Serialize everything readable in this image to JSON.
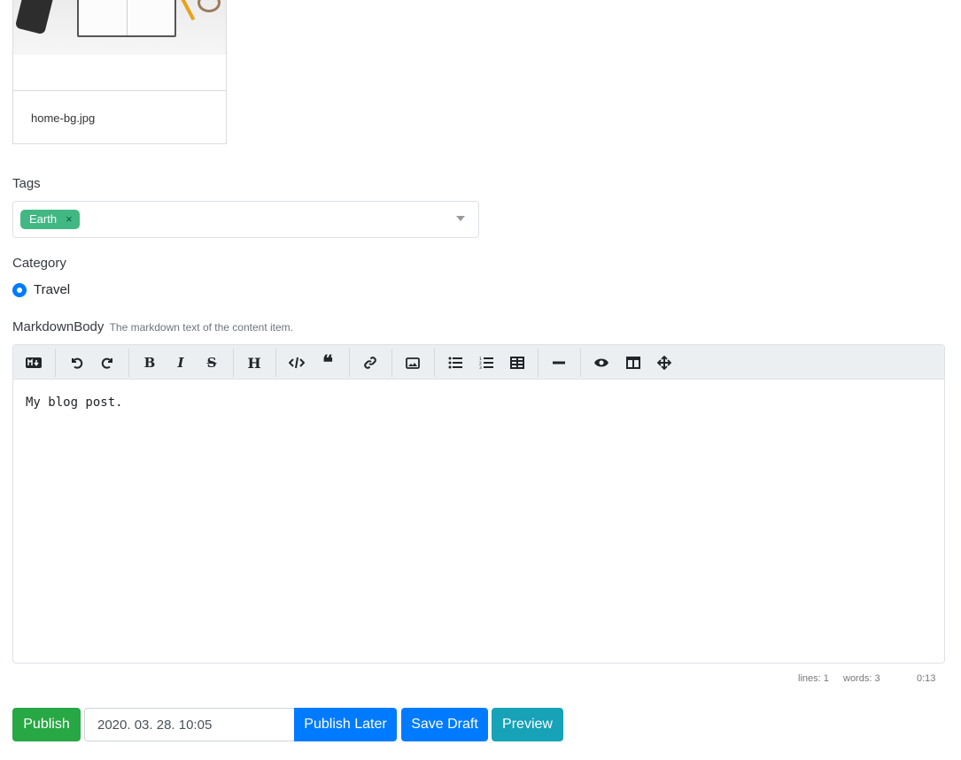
{
  "media": {
    "file_name": "home-bg.jpg"
  },
  "tags": {
    "label": "Tags",
    "selected": [
      "Earth"
    ]
  },
  "category": {
    "label": "Category",
    "selected": "Travel"
  },
  "markdown": {
    "label": "MarkdownBody",
    "hint": "The markdown text of the content item.",
    "content": "My blog post.",
    "toolbar_icons": [
      "markdown-guide-icon",
      "undo-icon",
      "redo-icon",
      "bold-icon",
      "italic-icon",
      "strikethrough-icon",
      "heading-icon",
      "code-icon",
      "quote-icon",
      "link-icon",
      "image-icon",
      "unordered-list-icon",
      "ordered-list-icon",
      "table-icon",
      "horizontal-rule-icon",
      "preview-icon",
      "side-by-side-icon",
      "fullscreen-icon"
    ],
    "status": {
      "lines": "lines: 1",
      "words": "words: 3",
      "cursor": "0:13"
    }
  },
  "actions": {
    "publish": "Publish",
    "publish_date": "2020. 03. 28. 10:05",
    "publish_later": "Publish Later",
    "save_draft": "Save Draft",
    "preview": "Preview"
  },
  "colors": {
    "tag": "#41b883",
    "primary": "#007bff",
    "success": "#28a745",
    "info": "#17a2b8"
  }
}
